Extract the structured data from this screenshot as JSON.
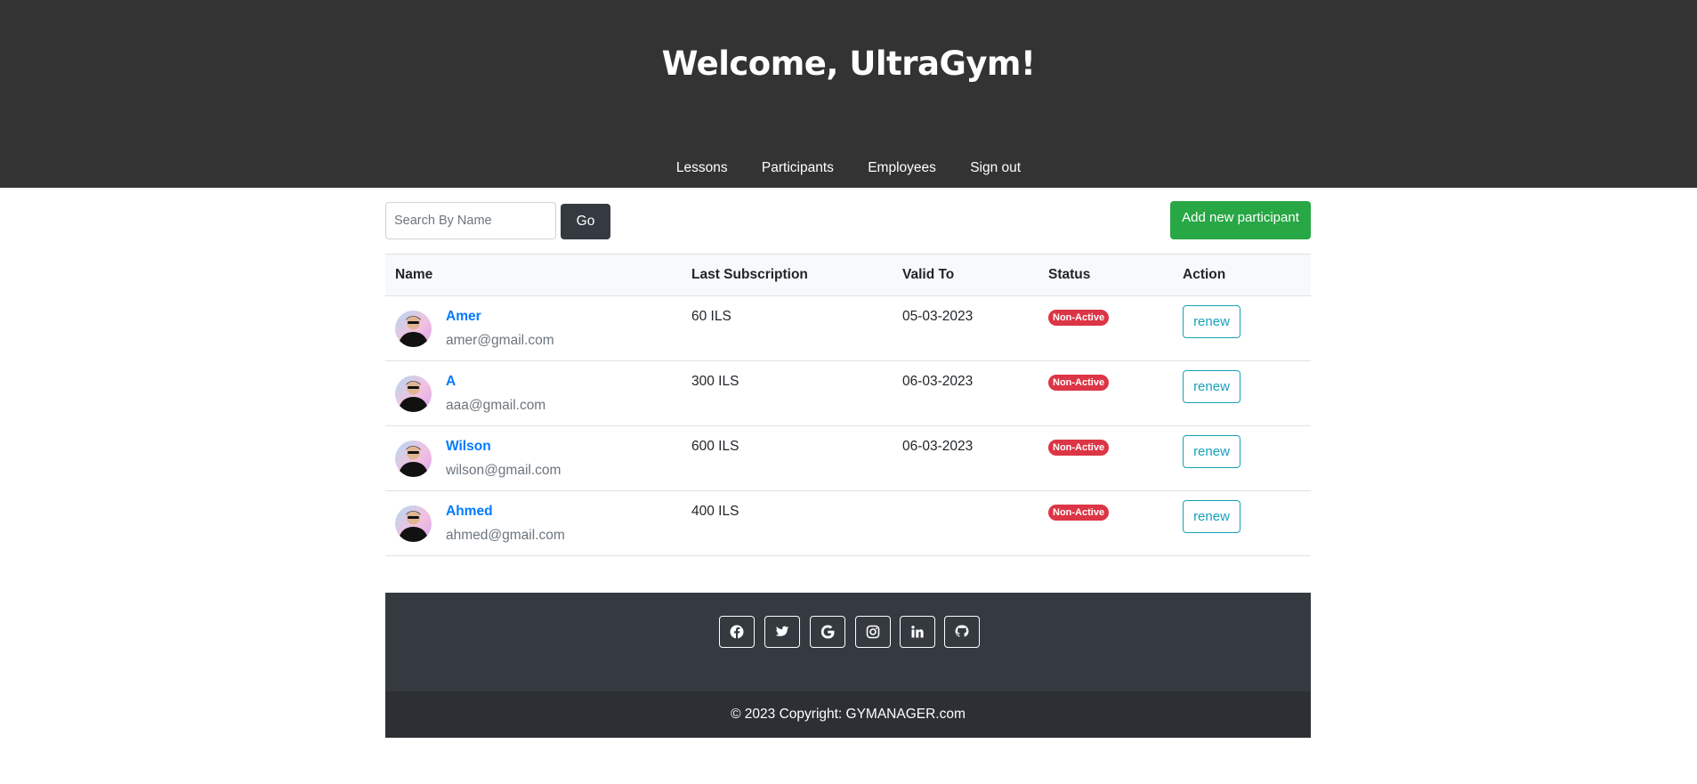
{
  "header": {
    "title": "Welcome, UltraGym!",
    "nav": [
      "Lessons",
      "Participants",
      "Employees",
      "Sign out"
    ]
  },
  "toolbar": {
    "search_placeholder": "Search By Name",
    "go_label": "Go",
    "add_label": "Add new participant"
  },
  "table": {
    "columns": [
      "Name",
      "Last Subscription",
      "Valid To",
      "Status",
      "Action"
    ],
    "rows": [
      {
        "name": "Amer",
        "email": "amer@gmail.com",
        "subscription": "60 ILS",
        "valid_to": "05-03-2023",
        "status": "Non-Active",
        "action": "renew"
      },
      {
        "name": "A",
        "email": "aaa@gmail.com",
        "subscription": "300 ILS",
        "valid_to": "06-03-2023",
        "status": "Non-Active",
        "action": "renew"
      },
      {
        "name": "Wilson",
        "email": "wilson@gmail.com",
        "subscription": "600 ILS",
        "valid_to": "06-03-2023",
        "status": "Non-Active",
        "action": "renew"
      },
      {
        "name": "Ahmed",
        "email": "ahmed@gmail.com",
        "subscription": "400 ILS",
        "valid_to": "",
        "status": "Non-Active",
        "action": "renew"
      }
    ]
  },
  "footer": {
    "social_icons": [
      "facebook-icon",
      "twitter-icon",
      "google-icon",
      "instagram-icon",
      "linkedin-icon",
      "github-icon"
    ],
    "copyright": "© 2023 Copyright: GYMANAGER.com"
  },
  "colors": {
    "header_bg": "#333333",
    "link": "#007bff",
    "add_button": "#28a745",
    "badge": "#dc3545",
    "renew": "#17a2b8",
    "footer_bg": "#343a40"
  }
}
